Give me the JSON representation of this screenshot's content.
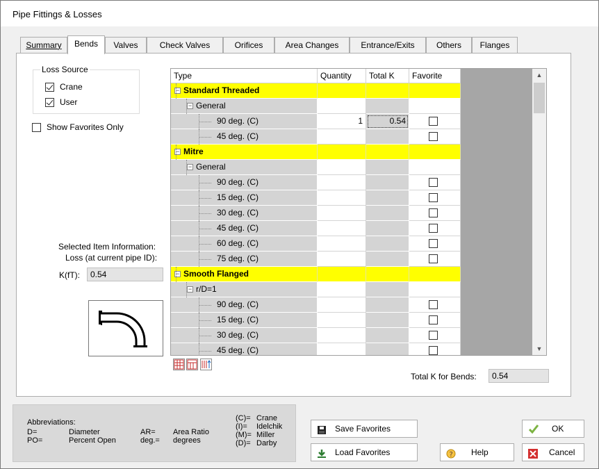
{
  "window": {
    "title": "Pipe Fittings & Losses"
  },
  "tabs": [
    {
      "label": "Summary"
    },
    {
      "label": "Bends"
    },
    {
      "label": "Valves"
    },
    {
      "label": "Check Valves"
    },
    {
      "label": "Orifices"
    },
    {
      "label": "Area Changes"
    },
    {
      "label": "Entrance/Exits"
    },
    {
      "label": "Others"
    },
    {
      "label": "Flanges"
    }
  ],
  "active_tab": "Bends",
  "loss_source": {
    "legend": "Loss Source",
    "crane_label": "Crane",
    "crane_checked": true,
    "user_label": "User",
    "user_checked": true
  },
  "show_favorites": {
    "label": "Show Favorites Only",
    "checked": false
  },
  "grid": {
    "headers": {
      "type": "Type",
      "quantity": "Quantity",
      "total_k": "Total K",
      "favorite": "Favorite"
    },
    "rows": [
      {
        "kind": "category",
        "label": "Standard Threaded"
      },
      {
        "kind": "group",
        "label": "General"
      },
      {
        "kind": "item",
        "label": "90 deg. (C)",
        "quantity": "1",
        "total_k": "0.54",
        "favorite": false
      },
      {
        "kind": "item",
        "label": "45 deg. (C)",
        "quantity": "",
        "total_k": "",
        "favorite": false
      },
      {
        "kind": "category",
        "label": "Mitre"
      },
      {
        "kind": "group",
        "label": "General"
      },
      {
        "kind": "item",
        "label": "90 deg. (C)",
        "quantity": "",
        "total_k": "",
        "favorite": false
      },
      {
        "kind": "item",
        "label": "15 deg. (C)",
        "quantity": "",
        "total_k": "",
        "favorite": false
      },
      {
        "kind": "item",
        "label": "30 deg. (C)",
        "quantity": "",
        "total_k": "",
        "favorite": false
      },
      {
        "kind": "item",
        "label": "45 deg. (C)",
        "quantity": "",
        "total_k": "",
        "favorite": false
      },
      {
        "kind": "item",
        "label": "60 deg. (C)",
        "quantity": "",
        "total_k": "",
        "favorite": false
      },
      {
        "kind": "item",
        "label": "75 deg. (C)",
        "quantity": "",
        "total_k": "",
        "favorite": false
      },
      {
        "kind": "category",
        "label": "Smooth Flanged"
      },
      {
        "kind": "group",
        "label": "r/D=1"
      },
      {
        "kind": "item",
        "label": "90 deg. (C)",
        "quantity": "",
        "total_k": "",
        "favorite": false
      },
      {
        "kind": "item",
        "label": "15 deg. (C)",
        "quantity": "",
        "total_k": "",
        "favorite": false
      },
      {
        "kind": "item",
        "label": "30 deg. (C)",
        "quantity": "",
        "total_k": "",
        "favorite": false
      },
      {
        "kind": "item",
        "label": "45 deg. (C)",
        "quantity": "",
        "total_k": "",
        "favorite": false
      }
    ]
  },
  "selected_info": {
    "heading": "Selected Item Information:",
    "subheading": "Loss (at current pipe ID):",
    "k_label": "K(fT):",
    "k_value": "0.54"
  },
  "total_k": {
    "label": "Total K for Bends:",
    "value": "0.54"
  },
  "abbreviations": {
    "heading": "Abbreviations:",
    "col1_keys": [
      "D=",
      "PO="
    ],
    "col1_vals": [
      "Diameter",
      "Percent Open"
    ],
    "col2_keys": [
      "AR=",
      "deg.="
    ],
    "col2_vals": [
      "Area Ratio",
      "degrees"
    ],
    "col3_keys": [
      "(C)=",
      "(I)=",
      "(M)=",
      "(D)="
    ],
    "col3_vals": [
      "Crane",
      "Idelchik",
      "Miller",
      "Darby"
    ]
  },
  "buttons": {
    "save_favorites": "Save Favorites",
    "load_favorites": "Load Favorites",
    "help": "Help",
    "ok": "OK",
    "cancel": "Cancel"
  },
  "colors": {
    "category_row": "#ffff00",
    "readonly_cell": "#d4d4d4",
    "ok_check": "#7cb342",
    "cancel_red": "#d32f2f"
  }
}
